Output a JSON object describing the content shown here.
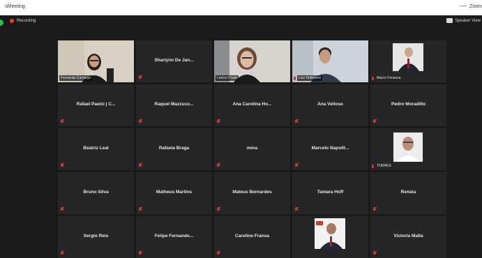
{
  "window": {
    "title": "üMeeting",
    "brand": "Zoom"
  },
  "toolbar": {
    "recording_label": "Recording",
    "speaker_view_label": "Speaker View"
  },
  "colors": {
    "active_speaker": "#9bdc3a",
    "muted_mic": "#d0342c",
    "recording": "#e8412c"
  },
  "participants": [
    {
      "name": "Fernanda Camargo",
      "video": true,
      "muted": false
    },
    {
      "name": "Sharlynn De Jan...",
      "video": false,
      "muted": true
    },
    {
      "name": "Lenice Prado",
      "video": true,
      "muted": false
    },
    {
      "name": "Luiz Hoffmann",
      "video": true,
      "muted": true
    },
    {
      "name": "Marco Fonseca",
      "video": true,
      "muted": true
    },
    {
      "name": "Rafael Paeixi | C...",
      "video": false,
      "muted": true
    },
    {
      "name": "Raquel Mazzuco...",
      "video": false,
      "muted": true
    },
    {
      "name": "Ana Carolina Ho...",
      "video": false,
      "muted": true
    },
    {
      "name": "Ana Velloso",
      "video": false,
      "muted": true
    },
    {
      "name": "Pedro Moradillo",
      "video": false,
      "muted": true
    },
    {
      "name": "Beatriz Leal",
      "video": false,
      "muted": true
    },
    {
      "name": "Rafaela Braga",
      "video": false,
      "muted": true
    },
    {
      "name": "mma",
      "video": false,
      "muted": true
    },
    {
      "name": "Marcelo Napolit...",
      "video": false,
      "muted": true
    },
    {
      "name": "TORRES",
      "video": true,
      "muted": true
    },
    {
      "name": "Bruno Silva",
      "video": false,
      "muted": true
    },
    {
      "name": "Matheus Martins",
      "video": false,
      "muted": true
    },
    {
      "name": "Mateus Bernardes",
      "video": false,
      "muted": true
    },
    {
      "name": "Tamara Hoff",
      "video": false,
      "muted": true
    },
    {
      "name": "Renata",
      "video": false,
      "muted": true
    },
    {
      "name": "Sergio Reis",
      "video": false,
      "muted": true
    },
    {
      "name": "Felipe Fernando...",
      "video": false,
      "muted": true
    },
    {
      "name": "Caroline Fransa",
      "video": false,
      "muted": true
    },
    {
      "name": "",
      "video": true,
      "muted": true
    },
    {
      "name": "Victoria Malta",
      "video": false,
      "muted": true
    }
  ]
}
